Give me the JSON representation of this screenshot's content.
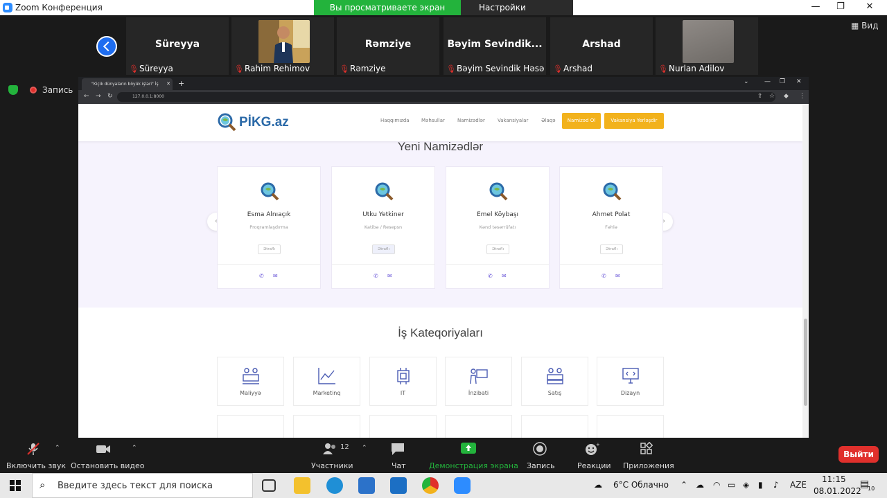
{
  "window": {
    "title": "Zoom Конференция"
  },
  "share_banner": {
    "text": "Вы просматриваете экран Arshad",
    "settings": "Настройки просмотра"
  },
  "participants": [
    {
      "display": "Süreyya",
      "footer": "Süreyya"
    },
    {
      "display": "",
      "footer": "Rahim Rehimov"
    },
    {
      "display": "Rəmziye",
      "footer": "Rəmziye"
    },
    {
      "display": "Bəyim  Sevindik...",
      "footer": "Bəyim Sevindik Həsən..."
    },
    {
      "display": "Arshad",
      "footer": "Arshad"
    },
    {
      "display": "",
      "footer": "Nurlan Adilov"
    }
  ],
  "view_button": "Вид",
  "recording": {
    "label": "Запись"
  },
  "browser": {
    "tab_title": "\"Kiçik dünyaların böyük işləri\" İş",
    "url": "127.0.0.1:8000"
  },
  "site": {
    "logo": "PİKG.az",
    "menu": [
      "Haqqımızda",
      "Məhsullar",
      "Namizədlər",
      "Vakansiyalar",
      "Əlaqə"
    ],
    "btn_candidate": "Namizəd Ol",
    "btn_vacancy": "Vakansiya Yerləşdir",
    "candidates_title": "Yeni Namizədlər",
    "more_label": "Ətraflı",
    "candidates": [
      {
        "name": "Esma Alnıaçık",
        "role": "Proqramlaşdırma"
      },
      {
        "name": "Utku Yetkiner",
        "role": "Katibə / Resepsn"
      },
      {
        "name": "Emel Köybaşı",
        "role": "Kənd təsərrüfatı"
      },
      {
        "name": "Ahmet Polat",
        "role": "Fəhlə"
      }
    ],
    "categories_title": "İş Kateqoriyaları",
    "categories": [
      "Maliyyə",
      "Marketinq",
      "IT",
      "İnzibati",
      "Satış",
      "Dizayn"
    ]
  },
  "toolbar": {
    "mute": "Включить звук",
    "video": "Остановить видео",
    "participants": "Участники",
    "participants_count": "12",
    "chat": "Чат",
    "share": "Демонстрация экрана",
    "record": "Запись",
    "reactions": "Реакции",
    "apps": "Приложения",
    "leave": "Выйти"
  },
  "taskbar": {
    "search_placeholder": "Введите здесь текст для поиска",
    "weather": "6°C  Облачно",
    "lang": "AZE",
    "time": "11:15",
    "date": "08.01.2022",
    "notifications": "10"
  },
  "colors": {
    "accent": "#23b33c",
    "zoom_blue": "#2d8cff",
    "leave_red": "#e0302c",
    "site_yellow": "#f2b21c",
    "site_purple": "#6a57d8"
  }
}
